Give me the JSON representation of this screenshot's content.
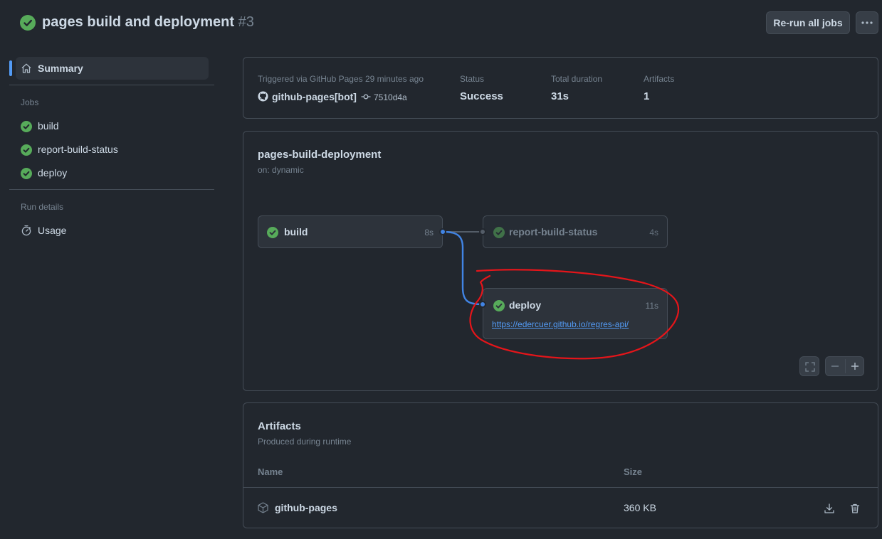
{
  "header": {
    "title": "pages build and deployment",
    "run_number": "#3",
    "rerun_label": "Re-run all jobs"
  },
  "sidebar": {
    "summary_label": "Summary",
    "jobs_heading": "Jobs",
    "jobs": [
      {
        "label": "build"
      },
      {
        "label": "report-build-status"
      },
      {
        "label": "deploy"
      }
    ],
    "run_details_heading": "Run details",
    "usage_label": "Usage"
  },
  "summary": {
    "trigger_text": "Triggered via GitHub Pages 29 minutes ago",
    "actor": "github-pages[bot]",
    "commit": "7510d4a",
    "status_label": "Status",
    "status_value": "Success",
    "duration_label": "Total duration",
    "duration_value": "31s",
    "artifacts_label": "Artifacts",
    "artifacts_value": "1"
  },
  "workflow": {
    "name": "pages-build-deployment",
    "trigger": "on: dynamic",
    "nodes": {
      "build": {
        "name": "build",
        "duration": "8s"
      },
      "report": {
        "name": "report-build-status",
        "duration": "4s"
      },
      "deploy": {
        "name": "deploy",
        "duration": "11s",
        "url": "https://edercuer.github.io/regres-api/"
      }
    }
  },
  "artifacts": {
    "title": "Artifacts",
    "subtitle": "Produced during runtime",
    "col_name": "Name",
    "col_size": "Size",
    "rows": [
      {
        "name": "github-pages",
        "size": "360 KB"
      }
    ]
  },
  "colors": {
    "success": "#57ab5a",
    "accent": "#539bf5",
    "annotation": "#e5151a"
  }
}
